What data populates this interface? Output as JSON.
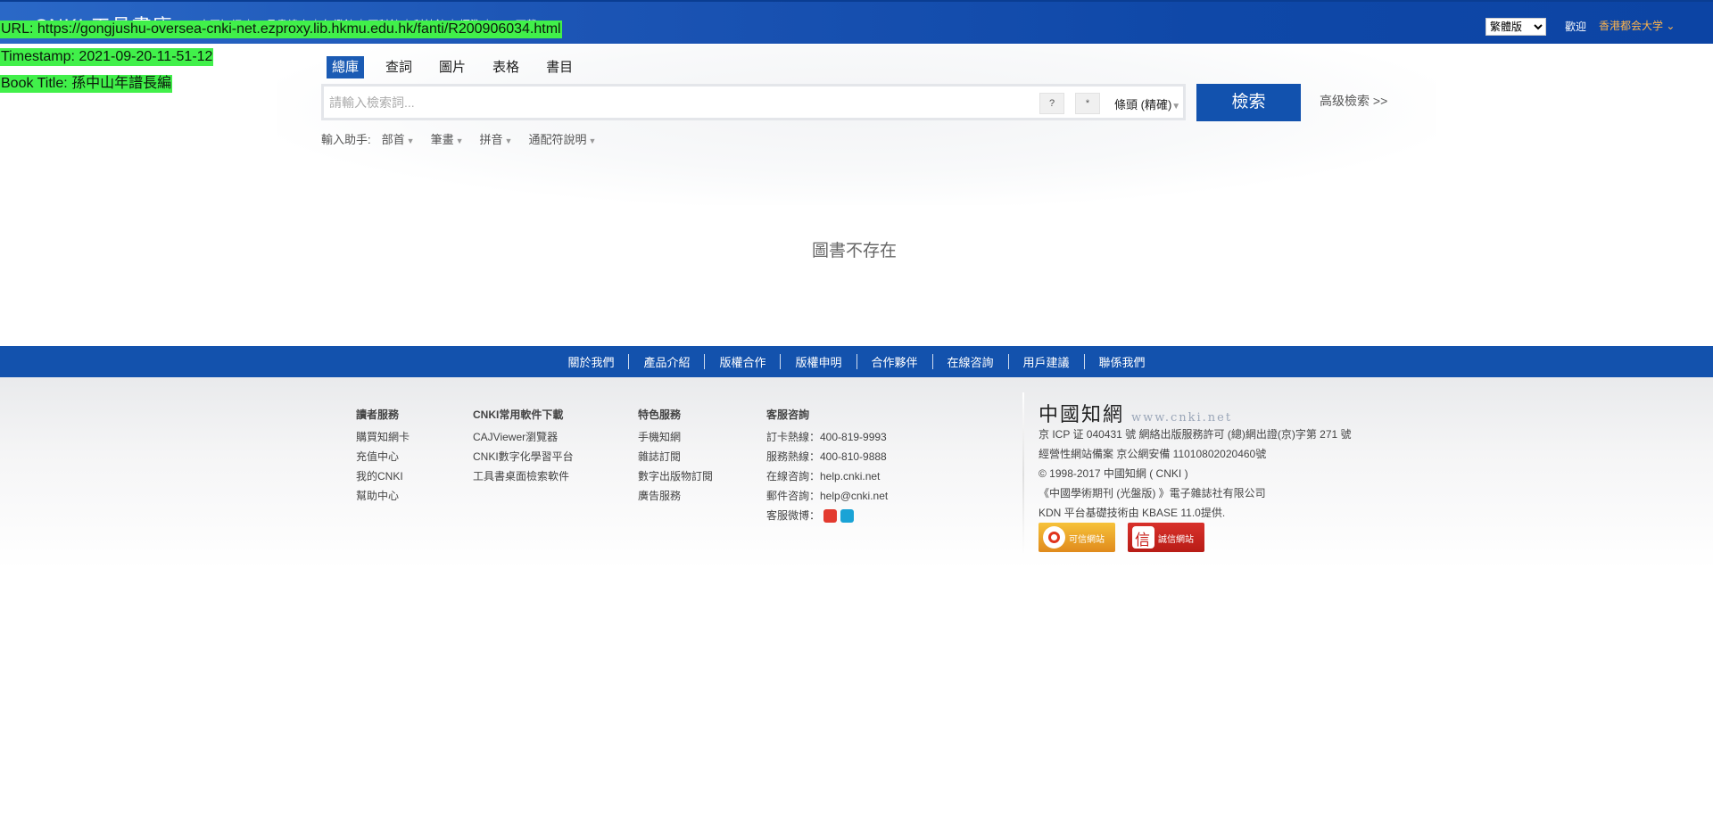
{
  "header": {
    "logo": "CNKI 工具書庫",
    "nav": [
      "中國知網",
      "工具書總庫",
      "年鑑館",
      "百科館",
      "科技館",
      "標準",
      "APP下載"
    ],
    "language": "繁體版",
    "welcome": "歡迎",
    "user_org": "香港都会大学"
  },
  "overlay": {
    "url": "URL: https://gongjushu-oversea-cnki-net.ezproxy.lib.hkmu.edu.hk/fanti/R200906034.html",
    "timestamp": "Timestamp: 2021-09-20-11-51-12",
    "book_title": "Book Title: 孫中山年譜長編"
  },
  "search": {
    "tabs": [
      "總庫",
      "查詞",
      "圖片",
      "表格",
      "書目"
    ],
    "active_tab": 0,
    "placeholder": "請輸入檢索詞...",
    "value": "",
    "help_btn": "?",
    "wildcard_btn": "*",
    "match_mode": "條頭 (精確)",
    "submit": "檢索",
    "advanced": "高级檢索 >>"
  },
  "assist": {
    "label": "輸入助手:",
    "options": [
      "部首",
      "筆畫",
      "拼音",
      "通配符說明"
    ]
  },
  "message": "圖書不存在",
  "footer_nav": [
    "關於我們",
    "產品介紹",
    "版權合作",
    "版權申明",
    "合作夥伴",
    "在線咨詢",
    "用戶建議",
    "聯係我們"
  ],
  "footer": {
    "col1": {
      "title": "讀者服務",
      "links": [
        "購買知網卡",
        "充值中心",
        "我的CNKI",
        "幫助中心"
      ]
    },
    "col2": {
      "title": "CNKI常用軟件下載",
      "links": [
        "CAJViewer瀏覽器",
        "CNKI數字化學習平台",
        "工具書桌面檢索軟件"
      ]
    },
    "col3": {
      "title": "特色服務",
      "links": [
        "手機知網",
        "雜誌訂閱",
        "數字出版物訂閱",
        "廣告服務"
      ]
    },
    "col4": {
      "title": "客服咨詢",
      "links": [
        "訂卡熱線：400-819-9993",
        "服務熱線：400-810-9888",
        "在線咨詢：help.cnki.net",
        "郵件咨詢：help@cnki.net",
        "客服微博："
      ]
    },
    "brand_cn": "中國知網",
    "brand_url": "www.cnki.net",
    "info": [
      "京 ICP 证 040431 號 網絡出版服務許可 (總)網出證(京)字第 271 號",
      "經營性網站備案 京公網安備 11010802020460號",
      "© 1998-2017 中國知網 ( CNKI )",
      "《中國學術期刊 (光盤版) 》電子雜誌社有限公司",
      "KDN 平台基礎技術由 KBASE 11.0提供."
    ],
    "badges": [
      "可信網站",
      "誠信網站"
    ]
  }
}
